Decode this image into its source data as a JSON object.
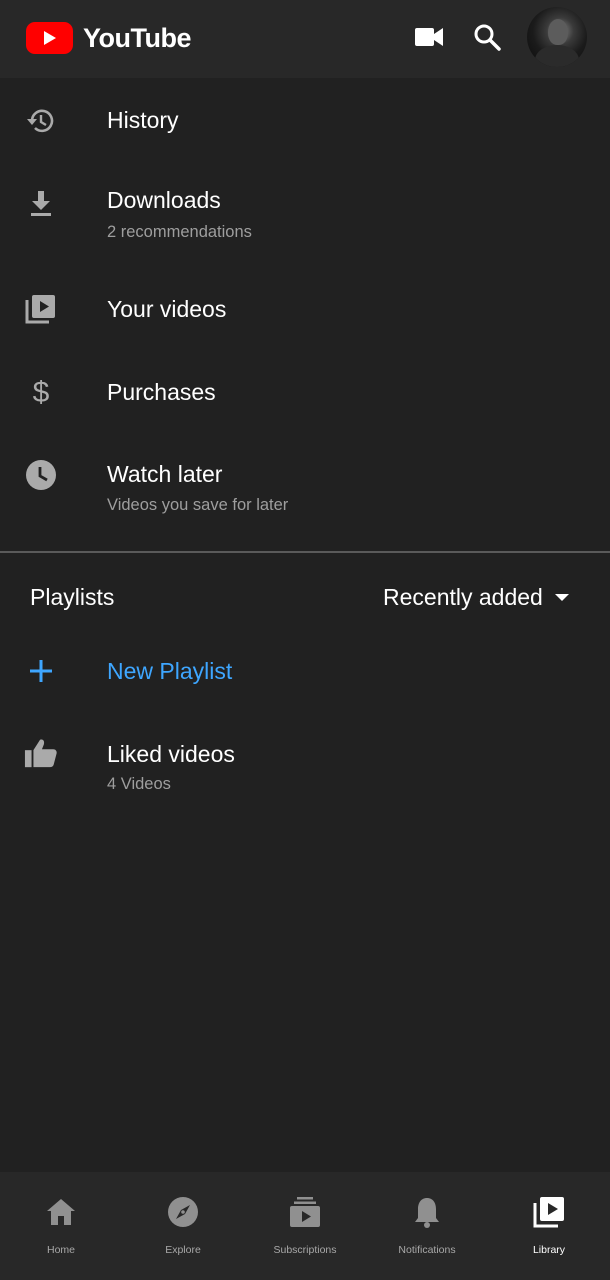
{
  "header": {
    "logo_text": "YouTube",
    "icons": [
      "camera-icon",
      "search-icon"
    ],
    "colors": {
      "brand": "#ff0000",
      "background": "#282828"
    }
  },
  "library": {
    "items": [
      {
        "icon": "history-icon",
        "title": "History",
        "subtitle": ""
      },
      {
        "icon": "download-icon",
        "title": "Downloads",
        "subtitle": "2 recommendations"
      },
      {
        "icon": "your-videos-icon",
        "title": "Your videos",
        "subtitle": ""
      },
      {
        "icon": "dollar-icon",
        "title": "Purchases",
        "subtitle": ""
      },
      {
        "icon": "clock-icon",
        "title": "Watch later",
        "subtitle": "Videos you save for later"
      }
    ]
  },
  "playlists": {
    "label": "Playlists",
    "sort_label": "Recently added",
    "new_playlist_label": "New Playlist",
    "accent_color": "#3ea6ff",
    "items": [
      {
        "icon": "thumbs-up-icon",
        "title": "Liked videos",
        "subtitle": "4 Videos"
      }
    ]
  },
  "bottom_nav": {
    "items": [
      {
        "icon": "home-icon",
        "label": "Home",
        "active": false
      },
      {
        "icon": "explore-icon",
        "label": "Explore",
        "active": false
      },
      {
        "icon": "subscriptions-icon",
        "label": "Subscriptions",
        "active": false
      },
      {
        "icon": "bell-icon",
        "label": "Notifications",
        "active": false
      },
      {
        "icon": "library-icon",
        "label": "Library",
        "active": true
      }
    ]
  }
}
